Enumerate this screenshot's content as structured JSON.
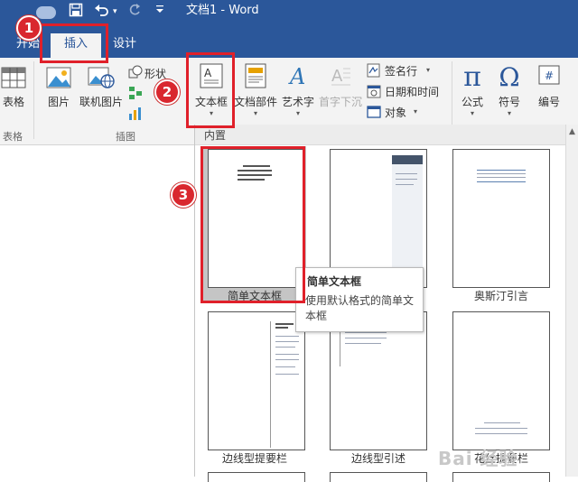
{
  "window": {
    "title": "文档1  -  Word"
  },
  "quick_access": {
    "redo_caret": "▾"
  },
  "tabs": [
    {
      "label": "开始"
    },
    {
      "label": "插入"
    },
    {
      "label": "设计"
    }
  ],
  "ribbon": {
    "table": {
      "label": "表格"
    },
    "picture": {
      "label": "图片"
    },
    "online_picture": {
      "label": "联机图片"
    },
    "shapes": {
      "label": "形状"
    },
    "textbox": {
      "label": "文本框"
    },
    "quick_parts": {
      "label": "文档部件"
    },
    "wordart": {
      "label": "艺术字"
    },
    "drop_cap": {
      "label": "首字下沉"
    },
    "signature_line": {
      "label": "签名行"
    },
    "date_time": {
      "label": "日期和时间"
    },
    "object": {
      "label": "对象"
    },
    "equation": {
      "label": "公式"
    },
    "symbol": {
      "label": "符号"
    },
    "number": {
      "label": "编号"
    },
    "groups": {
      "table": "表格",
      "illustrations": "插图"
    }
  },
  "gallery": {
    "header": "内置",
    "items": [
      {
        "label": "简单文本框"
      },
      {
        "label": ""
      },
      {
        "label": "奥斯汀引言"
      },
      {
        "label": "边线型提要栏"
      },
      {
        "label": "边线型引述"
      },
      {
        "label": "花丝提要栏"
      }
    ]
  },
  "tooltip": {
    "title": "简单文本框",
    "description": "使用默认格式的简单文本框"
  },
  "annotations": {
    "step1": "1",
    "step2": "2",
    "step3": "3"
  },
  "watermark": {
    "text": "Bai 经验"
  },
  "colors": {
    "accent": "#2b579a",
    "highlight": "#e0202a",
    "ribbon_bg": "#f3f3f3"
  }
}
